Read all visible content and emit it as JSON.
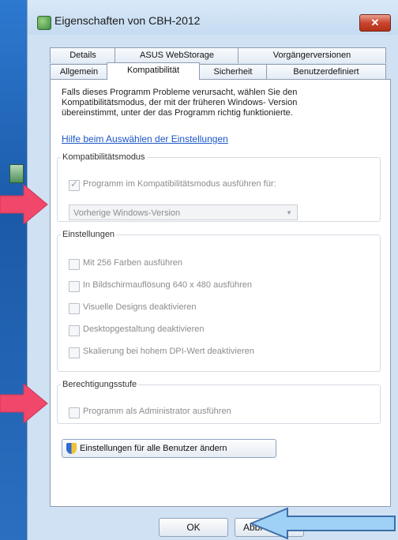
{
  "window": {
    "title": "Eigenschaften von CBH-2012",
    "close_label": "✕"
  },
  "tabs_top": [
    "Details",
    "ASUS WebStorage",
    "Vorgängerversionen"
  ],
  "tabs_bottom": [
    "Allgemein",
    "Kompatibilität",
    "Sicherheit",
    "Benutzerdefiniert"
  ],
  "active_tab": "Kompatibilität",
  "intro_text": "Falls dieses Programm Probleme verursacht, wählen Sie den Kompatibilitätsmodus, der mit der früheren Windows- Version übereinstimmt, unter der das Programm richtig funktionierte.",
  "help_link": "Hilfe beim Auswählen der Einstellungen",
  "compat": {
    "legend": "Kompatibilitätsmodus",
    "checkbox_label": "Programm im Kompatibilitätsmodus ausführen für:",
    "checkbox_checked": true,
    "select_value": "Vorherige Windows-Version"
  },
  "settings": {
    "legend": "Einstellungen",
    "items": [
      "Mit 256 Farben ausführen",
      "In Bildschirmauflösung 640 x 480 ausführen",
      "Visuelle Designs deaktivieren",
      "Desktopgestaltung deaktivieren",
      "Skalierung bei hohem DPI-Wert deaktivieren"
    ]
  },
  "privilege": {
    "legend": "Berechtigungsstufe",
    "checkbox_label": "Programm als Administrator ausführen"
  },
  "all_users_button": "Einstellungen für alle Benutzer ändern",
  "buttons": {
    "ok": "OK",
    "cancel": "Abbr"
  },
  "colors": {
    "annotation_arrow_red": "#f0476a",
    "annotation_arrow_blue": "#9fd0f5",
    "link": "#1a56c7"
  }
}
